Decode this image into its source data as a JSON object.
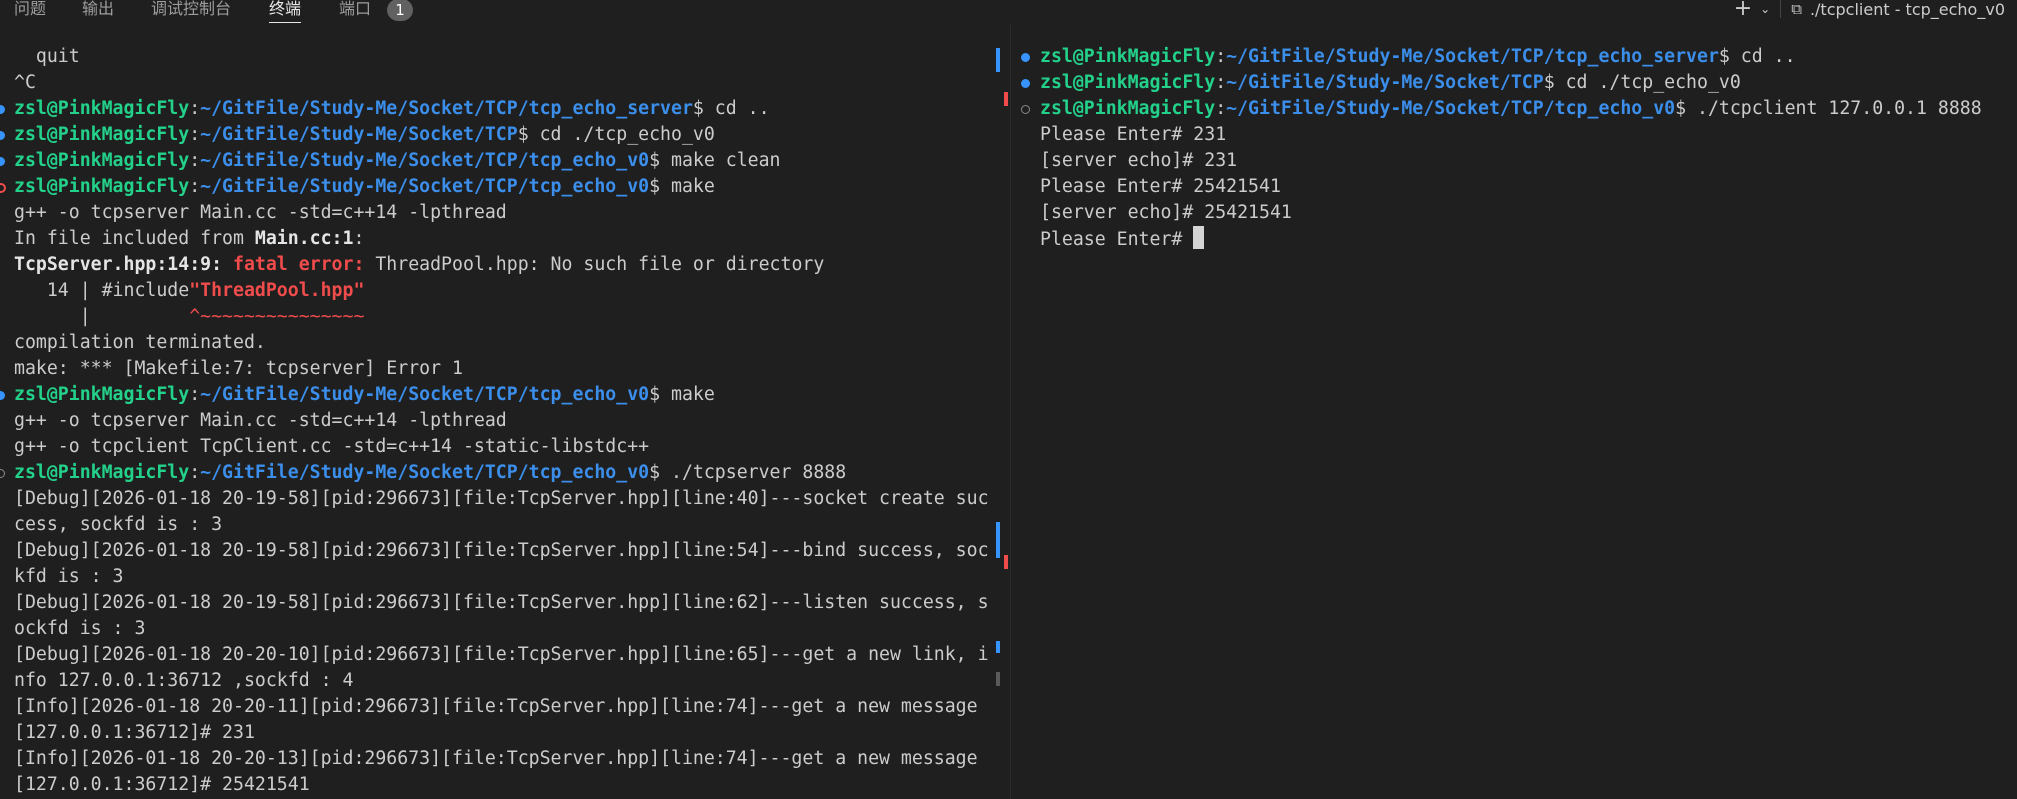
{
  "tabs": {
    "problems": "问题",
    "output": "输出",
    "debug_console": "调试控制台",
    "terminal": "终端",
    "ports": "端口",
    "ports_badge": "1"
  },
  "terminal_toolbar": {
    "terminal_name": "./tcpclient - tcp_echo_v0"
  },
  "prompt": {
    "user": "zsl@PinkMagicFly"
  },
  "left": {
    "l0": "  quit",
    "l1": "^C",
    "l2": {
      "path": "~/GitFile/Study-Me/Socket/TCP/tcp_echo_server",
      "cmd": " cd .."
    },
    "l3": {
      "path": "~/GitFile/Study-Me/Socket/TCP",
      "cmd": " cd ./tcp_echo_v0"
    },
    "l4": {
      "path": "~/GitFile/Study-Me/Socket/TCP/tcp_echo_v0",
      "cmd": " make clean"
    },
    "l5": {
      "path": "~/GitFile/Study-Me/Socket/TCP/tcp_echo_v0",
      "cmd": " make"
    },
    "l6": "g++ -o tcpserver Main.cc -std=c++14 -lpthread",
    "l7a": "In file included from ",
    "l7b": "Main.cc:1",
    "l7c": ":",
    "l8a": "TcpServer.hpp:14:9:",
    "l8b": "fatal error:",
    "l8c": " ThreadPool.hpp: No such file or directory",
    "l9a": "   14 | #include",
    "l9b": "\"ThreadPool.hpp\"",
    "l10a": "      |         ",
    "l10b": "^~~~~~~~~~~~~~~~",
    "l11": "compilation terminated.",
    "l12": "make: *** [Makefile:7: tcpserver] Error 1",
    "l13": {
      "path": "~/GitFile/Study-Me/Socket/TCP/tcp_echo_v0",
      "cmd": " make"
    },
    "l14": "g++ -o tcpserver Main.cc -std=c++14 -lpthread",
    "l15": "g++ -o tcpclient TcpClient.cc -std=c++14 -static-libstdc++",
    "l16": {
      "path": "~/GitFile/Study-Me/Socket/TCP/tcp_echo_v0",
      "cmd": " ./tcpserver 8888"
    },
    "l17": "[Debug][2026-01-18 20-19-58][pid:296673][file:TcpServer.hpp][line:40]---socket create suc",
    "l18": "cess, sockfd is : 3",
    "l19": "[Debug][2026-01-18 20-19-58][pid:296673][file:TcpServer.hpp][line:54]---bind success, soc",
    "l20": "kfd is : 3",
    "l21": "[Debug][2026-01-18 20-19-58][pid:296673][file:TcpServer.hpp][line:62]---listen success, s",
    "l22": "ockfd is : 3",
    "l23": "[Debug][2026-01-18 20-20-10][pid:296673][file:TcpServer.hpp][line:65]---get a new link, i",
    "l24": "nfo 127.0.0.1:36712 ,sockfd : 4",
    "l25": "[Info][2026-01-18 20-20-11][pid:296673][file:TcpServer.hpp][line:74]---get a new message",
    "l26": "[127.0.0.1:36712]# 231",
    "l27": "[Info][2026-01-18 20-20-13][pid:296673][file:TcpServer.hpp][line:74]---get a new message",
    "l28": "[127.0.0.1:36712]# 25421541"
  },
  "right": {
    "r0": {
      "path": "~/GitFile/Study-Me/Socket/TCP/tcp_echo_server",
      "cmd": " cd .."
    },
    "r1": {
      "path": "~/GitFile/Study-Me/Socket/TCP",
      "cmd": " cd ./tcp_echo_v0"
    },
    "r2": {
      "path": "~/GitFile/Study-Me/Socket/TCP/tcp_echo_v0",
      "cmd": " ./tcpclient 127.0.0.1 8888"
    },
    "r3": "Please Enter# 231",
    "r4": "[server echo]# 231",
    "r5": "Please Enter# 25421541",
    "r6": "[server echo]# 25421541",
    "r7": "Please Enter# "
  },
  "icons": {
    "add": "plus-icon",
    "dropdown": "chevron-down-icon",
    "shell": "terminal-shell-icon",
    "command_success": "blue-dot-icon",
    "command_error": "red-circle-icon",
    "command_running": "hollow-circle-icon"
  },
  "colors": {
    "background": "#1f1f1f",
    "prompt_user": "#23d18b",
    "prompt_path": "#3b8eea",
    "error": "#f14c4c",
    "decoration_blue": "#3794ff"
  }
}
